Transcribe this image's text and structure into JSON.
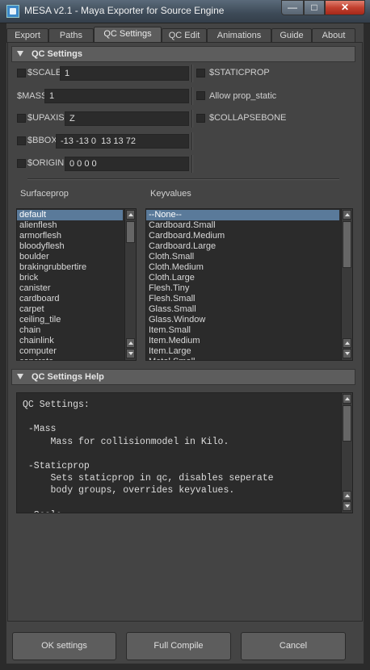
{
  "window": {
    "title": "MESA v2.1 - Maya Exporter for Source Engine",
    "min_label": "—",
    "max_label": "□",
    "close_label": "✕"
  },
  "tabs": [
    {
      "label": "Export"
    },
    {
      "label": "Paths"
    },
    {
      "label": "QC Settings"
    },
    {
      "label": "QC Edit"
    },
    {
      "label": "Animations"
    },
    {
      "label": "Guide"
    },
    {
      "label": "About"
    }
  ],
  "active_tab": "QC Settings",
  "qc_settings": {
    "header": "QC Settings",
    "scale_label": "$SCALE",
    "scale_value": "1",
    "mass_label": "$MASS",
    "mass_value": "1",
    "upaxis_label": "$UPAXIS",
    "upaxis_value": "Z",
    "bbox_label": "$BBOX",
    "bbox_value": "-13 -13 0  13 13 72",
    "origin_label": "$ORIGIN",
    "origin_value": "0 0 0 0",
    "staticprop_label": "$STATICPROP",
    "allow_prop_static_label": "Allow prop_static",
    "collapsebone_label": "$COLLAPSEBONE"
  },
  "surfaceprop": {
    "label": "Surfaceprop",
    "items": [
      "default",
      "alienflesh",
      "armorflesh",
      "bloodyflesh",
      "boulder",
      "brakingrubbertire",
      "brick",
      "canister",
      "cardboard",
      "carpet",
      "ceiling_tile",
      "chain",
      "chainlink",
      "computer",
      "concrete"
    ],
    "selected": "default"
  },
  "keyvalues": {
    "label": "Keyvalues",
    "items": [
      "--None--",
      "Cardboard.Small",
      "Cardboard.Medium",
      "Cardboard.Large",
      "Cloth.Small",
      "Cloth.Medium",
      "Cloth.Large",
      "Flesh.Tiny",
      "Flesh.Small",
      "Glass.Small",
      "Glass.Window",
      "Item.Small",
      "Item.Medium",
      "Item.Large",
      "Metal.Small"
    ],
    "selected": "--None--"
  },
  "help": {
    "header": "QC Settings Help",
    "lines": [
      "QC Settings:",
      "",
      " -Mass",
      "     Mass for collisionmodel in Kilo.",
      "",
      " -Staticprop",
      "     Sets staticprop in qc, disables seperate",
      "     body groups, overrides keyvalues.",
      "",
      " -Scale"
    ]
  },
  "buttons": {
    "ok": "OK settings",
    "compile": "Full Compile",
    "cancel": "Cancel"
  },
  "colors": {
    "background": "#444444",
    "field": "#2b2b2b",
    "selection": "#5a7a9a",
    "header": "#5d5d5d",
    "close": "#c2402f"
  }
}
